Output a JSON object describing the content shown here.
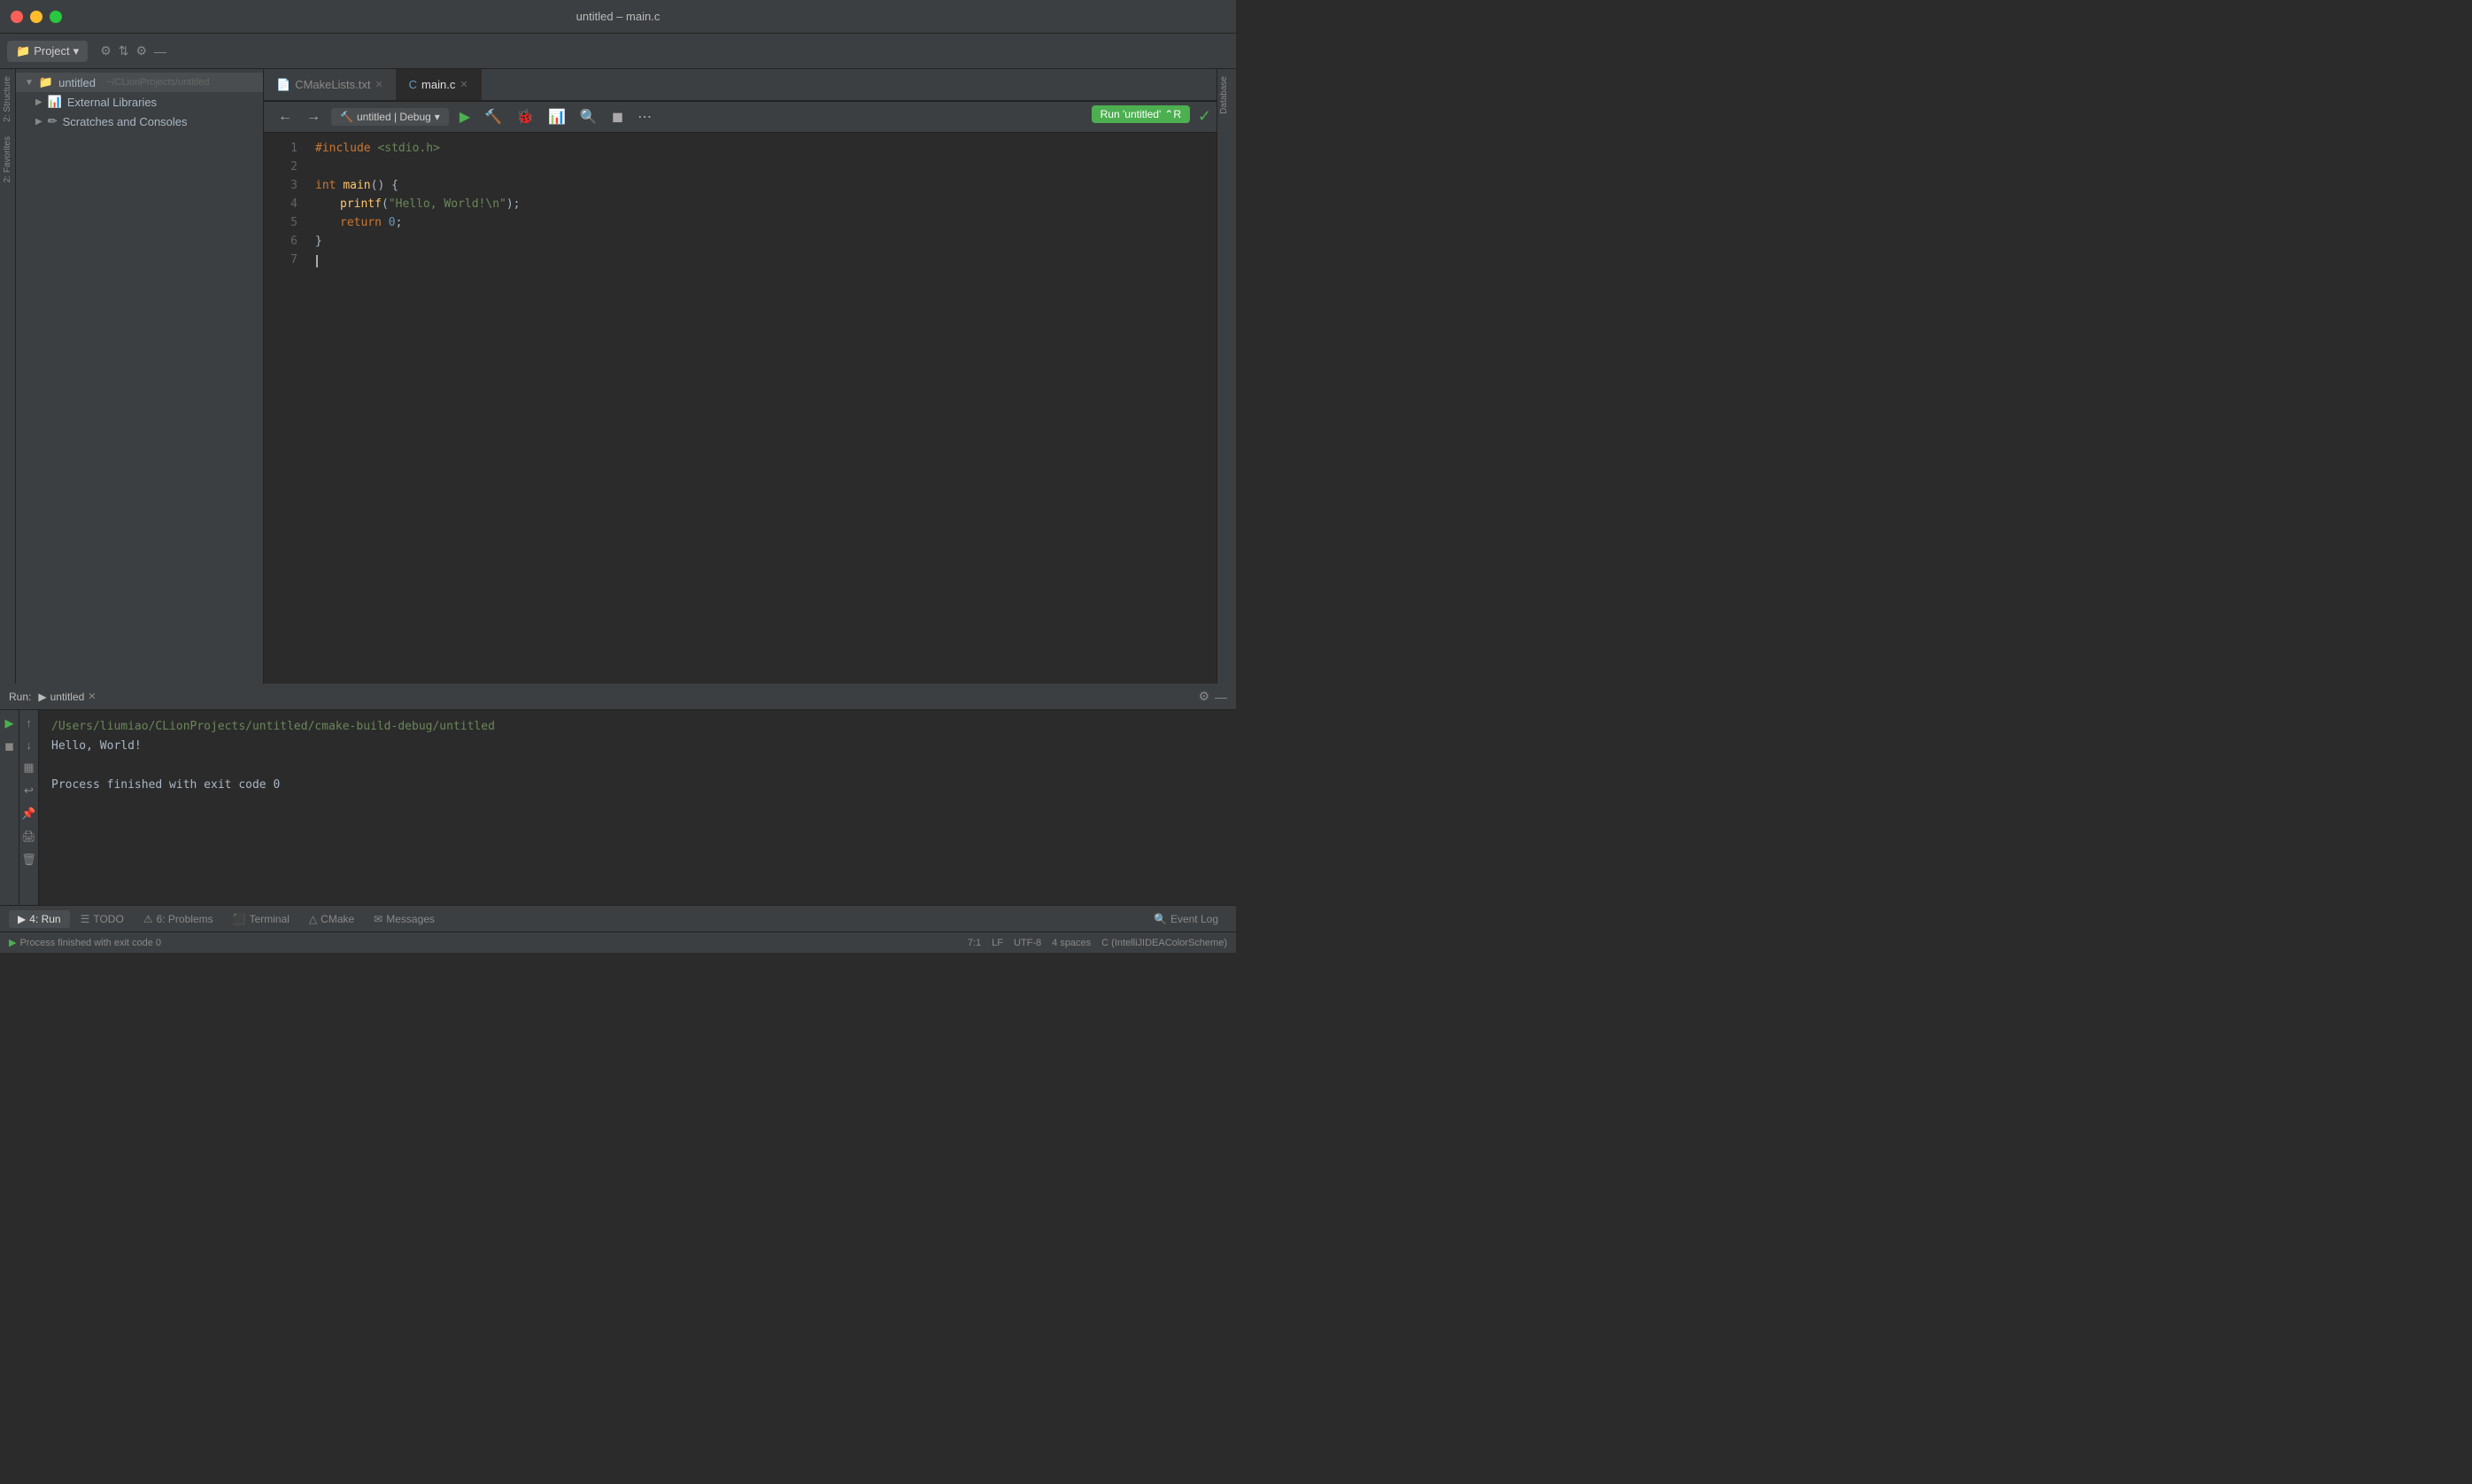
{
  "titleBar": {
    "title": "untitled – main.c"
  },
  "topToolbar": {
    "projectTab": "untitled",
    "fileTab1": "main.c"
  },
  "runToolbar": {
    "runConfig": "untitled | Debug",
    "runUntitledLabel": "Run 'untitled'",
    "shortcut": "⌃R"
  },
  "sidebar": {
    "header": "Project",
    "items": [
      {
        "label": "untitled",
        "path": "~/CLionProjects/untitled",
        "type": "folder",
        "expanded": true
      },
      {
        "label": "External Libraries",
        "type": "folder",
        "expanded": false
      },
      {
        "label": "Scratches and Consoles",
        "type": "folder",
        "expanded": false
      }
    ]
  },
  "editorTabs": [
    {
      "label": "CMakeLists.txt",
      "active": false
    },
    {
      "label": "main.c",
      "active": true
    }
  ],
  "codeLines": [
    {
      "num": "1",
      "content": "#include <stdio.h>",
      "type": "include"
    },
    {
      "num": "2",
      "content": "",
      "type": "empty"
    },
    {
      "num": "3",
      "content": "int main() {",
      "type": "fn-def"
    },
    {
      "num": "4",
      "content": "    printf(\"Hello, World!\\n\");",
      "type": "call"
    },
    {
      "num": "5",
      "content": "    return 0;",
      "type": "return"
    },
    {
      "num": "6",
      "content": "}",
      "type": "brace"
    },
    {
      "num": "7",
      "content": "",
      "type": "cursor"
    }
  ],
  "bottomPanel": {
    "runLabel": "Run:",
    "runTabName": "untitled",
    "terminalPath": "/Users/liumiao/CLionProjects/untitled/cmake-build-debug/untitled",
    "terminalOutput": "Hello, World!",
    "processStatus": "Process finished with exit code 0"
  },
  "bottomTabs": [
    {
      "label": "4: Run",
      "icon": "▶",
      "active": true
    },
    {
      "label": "TODO",
      "icon": "☰",
      "active": false
    },
    {
      "label": "6: Problems",
      "icon": "⚠",
      "active": false
    },
    {
      "label": "Terminal",
      "icon": "⬛",
      "active": false
    },
    {
      "label": "CMake",
      "icon": "△",
      "active": false
    },
    {
      "label": "Messages",
      "icon": "✉",
      "active": false
    },
    {
      "label": "Event Log",
      "icon": "🔍",
      "active": false
    }
  ],
  "statusBar": {
    "processMessage": "Process finished with exit code 0",
    "position": "7:1",
    "lineEnding": "LF",
    "encoding": "UTF-8",
    "indent": "4 spaces"
  },
  "icons": {
    "play": "▶",
    "stop": "◼",
    "debug": "🐞",
    "settings": "⚙",
    "close": "✕",
    "chevronDown": "▾",
    "chevronRight": "▶",
    "check": "✓"
  }
}
